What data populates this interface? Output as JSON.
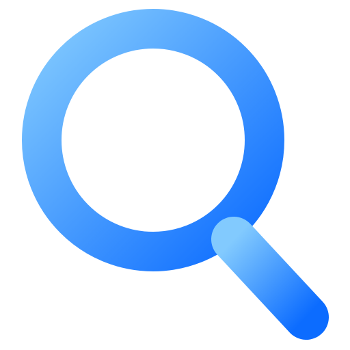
{
  "icon": {
    "name": "search-icon",
    "gradient_start": "#82CAFE",
    "gradient_end": "#0C6CFF",
    "background": "#FFFFFF"
  }
}
